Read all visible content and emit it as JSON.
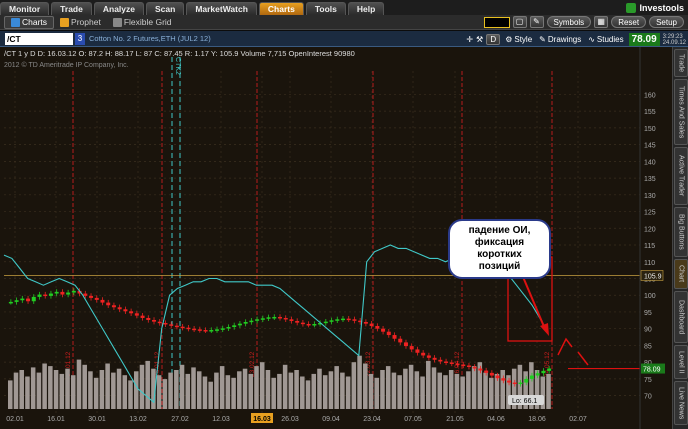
{
  "topnav": {
    "tabs": [
      "Monitor",
      "Trade",
      "Analyze",
      "Scan",
      "MarketWatch",
      "Charts",
      "Tools",
      "Help"
    ],
    "active": 5,
    "brand": "Investools"
  },
  "toolbar2": {
    "tabs": [
      "Charts",
      "Prophet",
      "Flexible Grid"
    ],
    "symbols": "Symbols",
    "reset": "Reset",
    "setup": "Setup"
  },
  "symbol": {
    "value": "/CT",
    "num": "3",
    "desc": "Cotton No. 2 Futures,ETH (JUL2 12)",
    "d": "D",
    "style": "Style",
    "drawings": "Drawings",
    "studies": "Studies",
    "quote": "78.09",
    "t1": "3:29:23",
    "t2": "24.09.12"
  },
  "study_line": "/CT 1 y D  D: 16.03.12  O: 87.2  H: 88.17  L: 87  C: 87.45  R: 1.17  Y: 105.9  Volume  7,715  OpenInterest  90980",
  "copyright": "2012 © TD Ameritrade IP Company, Inc.",
  "right_tabs": [
    "Trade",
    "Times And Sales",
    "Active Trader",
    "Big Buttons",
    "Chart",
    "Dashboard",
    "Level II",
    "Live News"
  ],
  "callout": {
    "lines": [
      "падение ОИ,",
      "фиксация",
      "коротких",
      "позиций"
    ]
  },
  "colors": {
    "bg": "#1a140c",
    "up": "#22cc22",
    "down": "#ee2222",
    "oi": "#40c8c8",
    "annotation": "#dd1111",
    "volume": "#a09894",
    "level": "#c8a040",
    "accent": "#e8a020"
  },
  "chart_data": {
    "type": "candlestick",
    "title": "/CT 1 y D",
    "y_ticks": [
      160,
      155,
      150,
      145,
      140,
      135,
      130,
      125,
      120,
      115,
      110,
      105,
      100,
      95,
      90,
      85,
      80,
      75,
      70
    ],
    "y_range": [
      66,
      167
    ],
    "x_labels": [
      "02.01",
      "16.01",
      "30.01",
      "13.02",
      "27.02",
      "12.03",
      "16.03",
      "26.03",
      "09.04",
      "23.04",
      "07.05",
      "21.05",
      "04.06",
      "18.06",
      "02.07"
    ],
    "x_highlight": "16.03",
    "rotated_labels": [
      "CTH2",
      "CTK2",
      "CTN2"
    ],
    "rotated_dates": [
      "04.01.12",
      "26.01.12",
      "23.02.12",
      "22.03.12",
      "26.04.12",
      "24.05.12"
    ],
    "markers": {
      "price_level": "105.9",
      "last": "78.09",
      "low_bubble": "Lo: 66.1"
    },
    "series": [
      {
        "name": "Price",
        "values": [
          98,
          98.5,
          99,
          98.2,
          99.5,
          100.2,
          99.8,
          100.5,
          101,
          100.2,
          100.8,
          101.3,
          100.5,
          99.8,
          99.2,
          98.6,
          97.8,
          97,
          96.4,
          95.8,
          95.2,
          94.6,
          93.9,
          93.2,
          92.6,
          92.1,
          91.7,
          91.3,
          90.9,
          90.6,
          90.3,
          90,
          89.8,
          89.6,
          89.5,
          89.6,
          89.8,
          90.1,
          90.5,
          91,
          91.5,
          92,
          92.4,
          92.8,
          93.1,
          93.4,
          93.5,
          93.2,
          92.8,
          92.3,
          91.8,
          91.4,
          91.2,
          91.4,
          91.7,
          92.1,
          92.5,
          92.8,
          93,
          92.8,
          92.4,
          92,
          91.5,
          90.8,
          90,
          89.1,
          88.1,
          87,
          85.9,
          84.8,
          83.8,
          82.8,
          82,
          81.3,
          80.7,
          80.2,
          79.9,
          79.6,
          79.3,
          79,
          78.6,
          78.1,
          77.5,
          76.8,
          76,
          75.2,
          74.5,
          73.9,
          73.5,
          73.9,
          75,
          76,
          76.7,
          77.4,
          78.1
        ]
      },
      {
        "name": "OpenInterest",
        "values": [
          112,
          111,
          108,
          105,
          104,
          103,
          104,
          105,
          104,
          103,
          100,
          96,
          92,
          88,
          84,
          80,
          76,
          72,
          70,
          68,
          90,
          100,
          102,
          103,
          104,
          104,
          105,
          105,
          104,
          104,
          104,
          104,
          103,
          103,
          103,
          102,
          100,
          98,
          96,
          94,
          92,
          90,
          88,
          86,
          84,
          82,
          110,
          113,
          114,
          115,
          114,
          114,
          113,
          112,
          111,
          111,
          110,
          111,
          112,
          112,
          111,
          110,
          109,
          108,
          106,
          103,
          100,
          97,
          93,
          89
        ]
      },
      {
        "name": "Volume",
        "values": [
          22,
          28,
          30,
          25,
          32,
          28,
          35,
          33,
          30,
          27,
          31,
          26,
          38,
          34,
          29,
          24,
          30,
          35,
          28,
          31,
          26,
          22,
          29,
          34,
          37,
          31,
          26,
          23,
          28,
          30,
          34,
          27,
          32,
          29,
          25,
          21,
          28,
          33,
          26,
          24,
          29,
          31,
          27,
          33,
          36,
          30,
          24,
          27,
          34,
          28,
          30,
          25,
          22,
          27,
          31,
          26,
          29,
          33,
          28,
          25,
          36,
          41,
          35,
          27,
          24,
          30,
          33,
          28,
          26,
          31,
          34,
          29,
          25,
          37,
          32,
          28,
          26,
          30,
          27,
          25,
          29,
          33,
          36,
          28,
          24,
          27,
          30,
          26,
          31,
          34,
          29,
          36,
          30,
          25,
          27
        ]
      }
    ]
  }
}
